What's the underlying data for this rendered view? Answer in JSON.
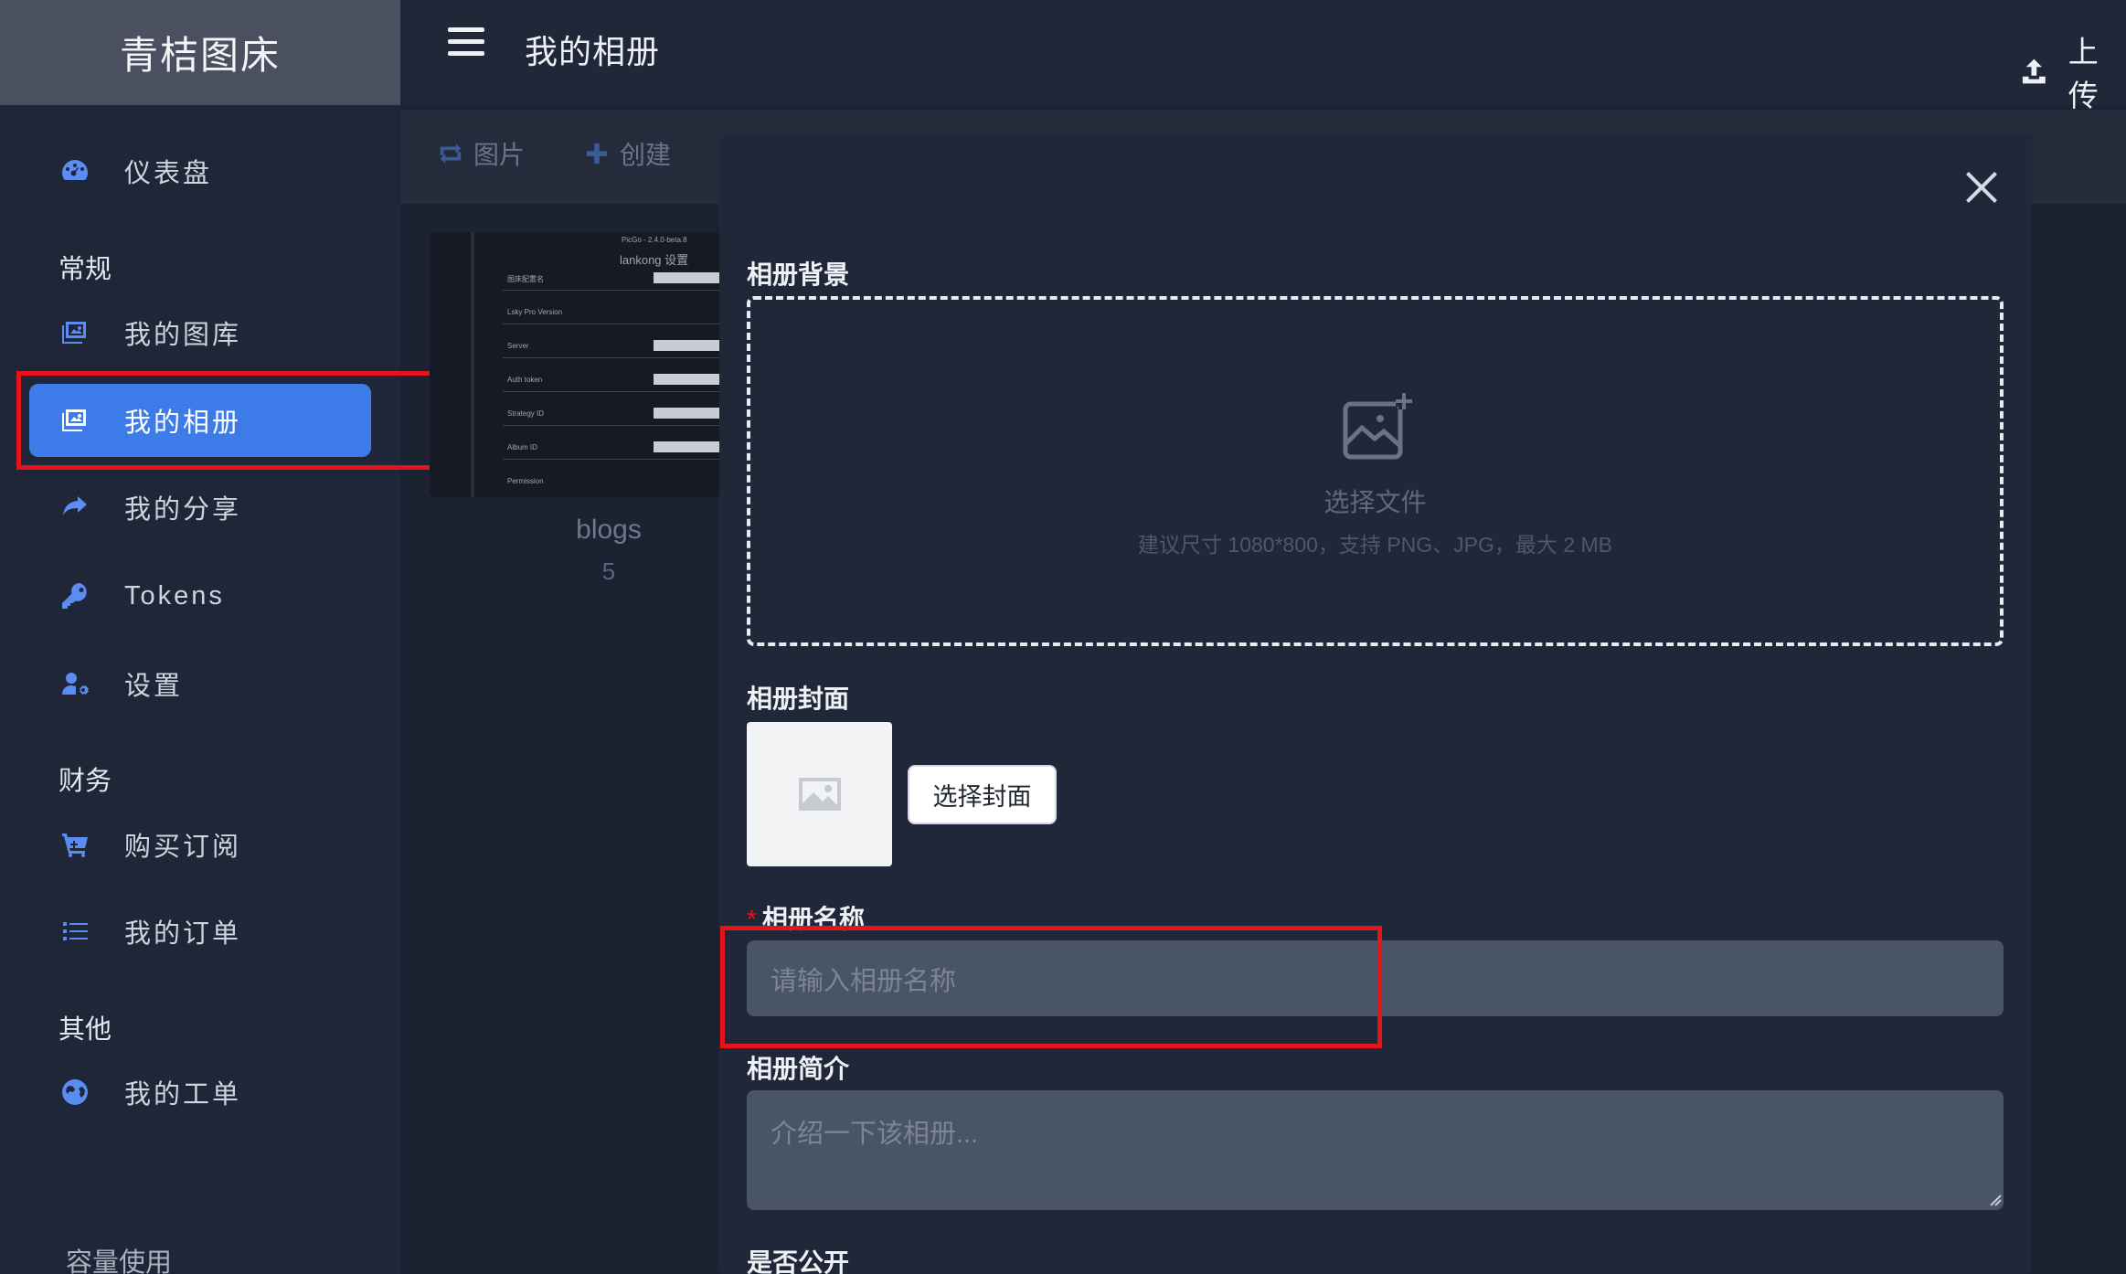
{
  "brand": "青桔图床",
  "header": {
    "title": "我的相册",
    "upload_label": "上传"
  },
  "sidebar": {
    "items": [
      {
        "label": "仪表盘",
        "icon": "dashboard-icon"
      },
      {
        "label": "我的图库",
        "icon": "gallery-icon"
      },
      {
        "label": "我的相册",
        "icon": "album-icon",
        "active": true
      },
      {
        "label": "我的分享",
        "icon": "share-icon"
      },
      {
        "label": "Tokens",
        "icon": "key-icon"
      },
      {
        "label": "设置",
        "icon": "user-settings-icon"
      },
      {
        "label": "购买订阅",
        "icon": "cart-icon"
      },
      {
        "label": "我的订单",
        "icon": "list-icon"
      },
      {
        "label": "我的工单",
        "icon": "globe-icon"
      }
    ],
    "sections": [
      "常规",
      "财务",
      "其他"
    ],
    "footer": "容量使用"
  },
  "toolbar": {
    "images": "图片",
    "create": "创建"
  },
  "album": {
    "name": "blogs",
    "count": "5"
  },
  "thumbnail": {
    "version": "PicGo - 2.4.0-beta.8",
    "title": "lankong 设置",
    "rows": [
      "图床配置名",
      "Lsky Pro Version",
      "Server",
      "Auth token",
      "Strategy ID",
      "Album ID",
      "Permission"
    ]
  },
  "modal": {
    "background_label": "相册背景",
    "choose_file": "选择文件",
    "hint": "建议尺寸 1080*800，支持 PNG、JPG，最大 2 MB",
    "cover_label": "相册封面",
    "cover_button": "选择封面",
    "required_mark": "*",
    "name_label": "相册名称",
    "name_placeholder": "请输入相册名称",
    "desc_label": "相册简介",
    "desc_placeholder": "介绍一下该相册...",
    "public_label": "是否公开"
  },
  "colors": {
    "accent": "#3d7ce8",
    "highlight": "#e4141a",
    "background": "#1b2232"
  }
}
